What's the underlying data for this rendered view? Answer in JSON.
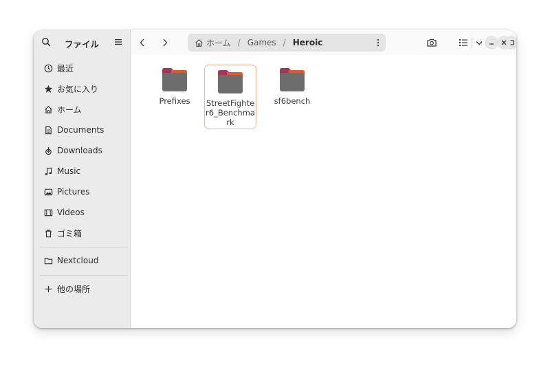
{
  "sidebar": {
    "title": "ファイル",
    "items": [
      {
        "label": "最近",
        "icon": "clock-icon"
      },
      {
        "label": "お気に入り",
        "icon": "star-icon"
      },
      {
        "label": "ホーム",
        "icon": "home-icon"
      },
      {
        "label": "Documents",
        "icon": "document-icon"
      },
      {
        "label": "Downloads",
        "icon": "download-icon"
      },
      {
        "label": "Music",
        "icon": "music-icon"
      },
      {
        "label": "Pictures",
        "icon": "picture-icon"
      },
      {
        "label": "Videos",
        "icon": "video-icon"
      },
      {
        "label": "ゴミ箱",
        "icon": "trash-icon"
      }
    ],
    "network_items": [
      {
        "label": "Nextcloud",
        "icon": "folder-icon"
      }
    ],
    "other_locations": {
      "label": "他の場所",
      "icon": "plus-icon"
    }
  },
  "pathbar": {
    "crumbs": [
      "ホーム",
      "Games",
      "Heroic"
    ],
    "separator": "/"
  },
  "files": [
    {
      "name": "Prefixes",
      "selected": false
    },
    {
      "name": "StreetFighter6_Benchmark",
      "selected": true
    },
    {
      "name": "sf6bench",
      "selected": false
    }
  ],
  "colors": {
    "folder_top": "#a5355a",
    "folder_accent": "#e2582b",
    "folder_body": "#6d6d6d",
    "selection_border": "#f0b796"
  }
}
